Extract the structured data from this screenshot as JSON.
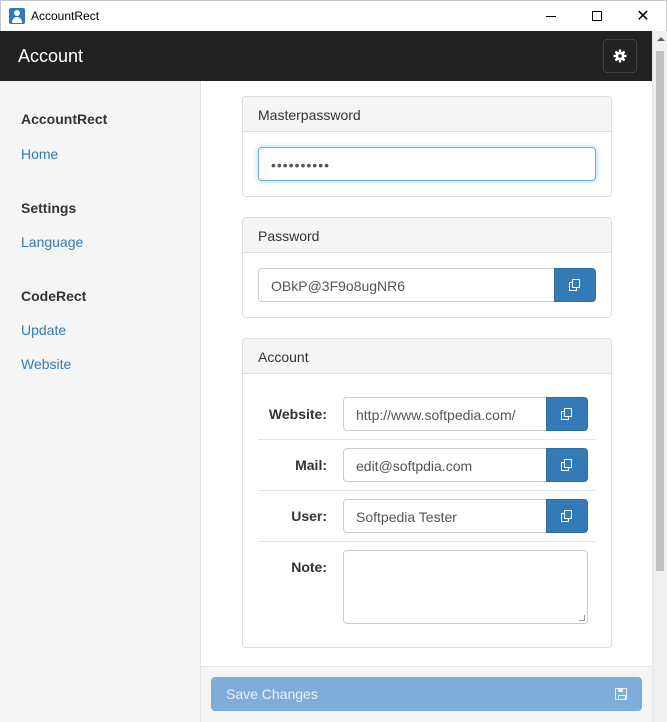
{
  "window": {
    "title": "AccountRect",
    "close_glyph": "✕"
  },
  "header": {
    "title": "Account",
    "settings_icon": "gear-icon"
  },
  "sidebar": {
    "sections": [
      {
        "heading": "AccountRect",
        "links": [
          "Home"
        ]
      },
      {
        "heading": "Settings",
        "links": [
          "Language"
        ]
      },
      {
        "heading": "CodeRect",
        "links": [
          "Update",
          "Website"
        ]
      }
    ]
  },
  "masterpassword": {
    "heading": "Masterpassword",
    "value": "••••••••••"
  },
  "password": {
    "heading": "Password",
    "value": "OBkP@3F9o8ugNR6"
  },
  "account": {
    "heading": "Account",
    "website_label": "Website:",
    "website_value": "http://www.softpedia.com/",
    "mail_label": "Mail:",
    "mail_value": "edit@softpdia.com",
    "user_label": "User:",
    "user_value": "Softpedia Tester",
    "note_label": "Note:",
    "note_value": ""
  },
  "footer": {
    "save_label": "Save Changes"
  },
  "colors": {
    "header_bg": "#222222",
    "link": "#337ab7",
    "primary": "#337ab7",
    "save_disabled": "#7fadd9"
  }
}
